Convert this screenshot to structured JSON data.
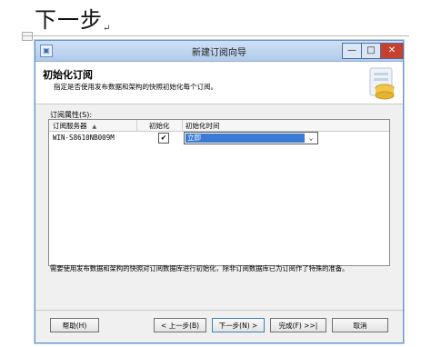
{
  "document": {
    "heading": "下一步",
    "paragraph_mark": "↵"
  },
  "window": {
    "title": "新建订阅向导",
    "minimize_glyph": "—",
    "maximize_glyph": "□",
    "close_glyph": "✕",
    "icon": "wizard-app-icon"
  },
  "header": {
    "title": "初始化订阅",
    "description": "指定是否使用发布数据和架构的快照初始化每个订阅。"
  },
  "grid": {
    "group_label": "订阅属性(S):",
    "columns": [
      "订阅服务器",
      "初始化",
      "初始化时间"
    ],
    "sort_indicator": "▲",
    "rows": [
      {
        "server": "WIN-S8610NB009M",
        "initialize": true,
        "init_time": "立即"
      }
    ]
  },
  "hint": "需要使用发布数据和架构的快照对订阅数据库进行初始化，除非订阅数据库已为订阅作了特殊的准备。",
  "buttons": {
    "help": "帮助(H)",
    "back": "< 上一步(B)",
    "next": "下一步(N) >",
    "finish": "完成(F) >>|",
    "cancel": "取消"
  }
}
